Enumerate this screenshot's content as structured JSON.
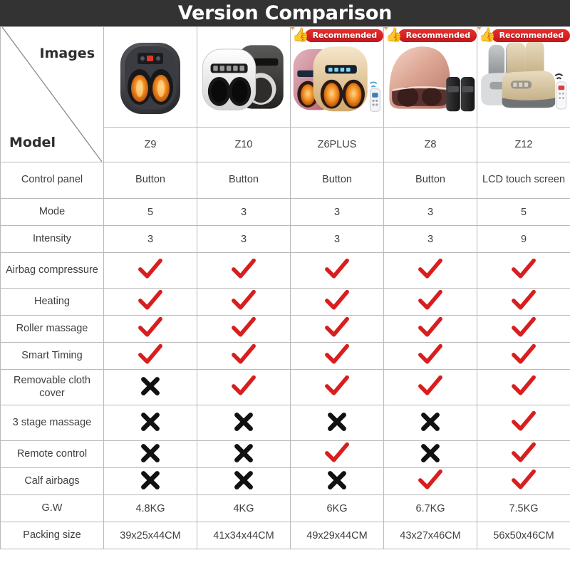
{
  "header": {
    "title": "Version Comparison",
    "background_color": "#333333",
    "text_color": "#ffffff"
  },
  "corner": {
    "images_label": "Images",
    "model_label": "Model"
  },
  "badge": {
    "label": "Recommended",
    "color": "#d41f22",
    "icon": "thumbs-up-icon"
  },
  "colors": {
    "check": "#d81e1e",
    "cross": "#111111",
    "grid": "#b9b9b9",
    "text": "#3f3f3f"
  },
  "models": [
    {
      "name": "Z9",
      "recommended": false,
      "image": "foot-massager-black"
    },
    {
      "name": "Z10",
      "recommended": false,
      "image": "foot-massager-white-black"
    },
    {
      "name": "Z6PLUS",
      "recommended": true,
      "image": "foot-massager-gold-pink-remote"
    },
    {
      "name": "Z8",
      "recommended": true,
      "image": "foot-massager-rosegold-calf"
    },
    {
      "name": "Z12",
      "recommended": true,
      "image": "leg-massager-beige-remote"
    }
  ],
  "rows": [
    {
      "label": "Control panel",
      "values": [
        "Button",
        "Button",
        "Button",
        "Button",
        "LCD touch screen"
      ],
      "type": "text",
      "two_line": true
    },
    {
      "label": "Mode",
      "values": [
        "5",
        "3",
        "3",
        "3",
        "5"
      ],
      "type": "text",
      "two_line": false
    },
    {
      "label": "Intensity",
      "values": [
        "3",
        "3",
        "3",
        "3",
        "9"
      ],
      "type": "text",
      "two_line": false
    },
    {
      "label": "Airbag compressure",
      "values": [
        "check",
        "check",
        "check",
        "check",
        "check"
      ],
      "type": "mark",
      "two_line": true
    },
    {
      "label": "Heating",
      "values": [
        "check",
        "check",
        "check",
        "check",
        "check"
      ],
      "type": "mark",
      "two_line": false
    },
    {
      "label": "Roller massage",
      "values": [
        "check",
        "check",
        "check",
        "check",
        "check"
      ],
      "type": "mark",
      "two_line": false
    },
    {
      "label": "Smart Timing",
      "values": [
        "check",
        "check",
        "check",
        "check",
        "check"
      ],
      "type": "mark",
      "two_line": false
    },
    {
      "label": "Removable cloth cover",
      "values": [
        "cross",
        "check",
        "check",
        "check",
        "check"
      ],
      "type": "mark",
      "two_line": true
    },
    {
      "label": "3 stage massage",
      "values": [
        "cross",
        "cross",
        "cross",
        "cross",
        "check"
      ],
      "type": "mark",
      "two_line": true
    },
    {
      "label": "Remote control",
      "values": [
        "cross",
        "cross",
        "check",
        "cross",
        "check"
      ],
      "type": "mark",
      "two_line": false
    },
    {
      "label": "Calf airbags",
      "values": [
        "cross",
        "cross",
        "cross",
        "check",
        "check"
      ],
      "type": "mark",
      "two_line": false
    },
    {
      "label": "G.W",
      "values": [
        "4.8KG",
        "4KG",
        "6KG",
        "6.7KG",
        "7.5KG"
      ],
      "type": "text",
      "two_line": false
    },
    {
      "label": "Packing size",
      "values": [
        "39x25x44CM",
        "41x34x44CM",
        "49x29x44CM",
        "43x27x46CM",
        "56x50x46CM"
      ],
      "type": "text",
      "two_line": false
    }
  ]
}
